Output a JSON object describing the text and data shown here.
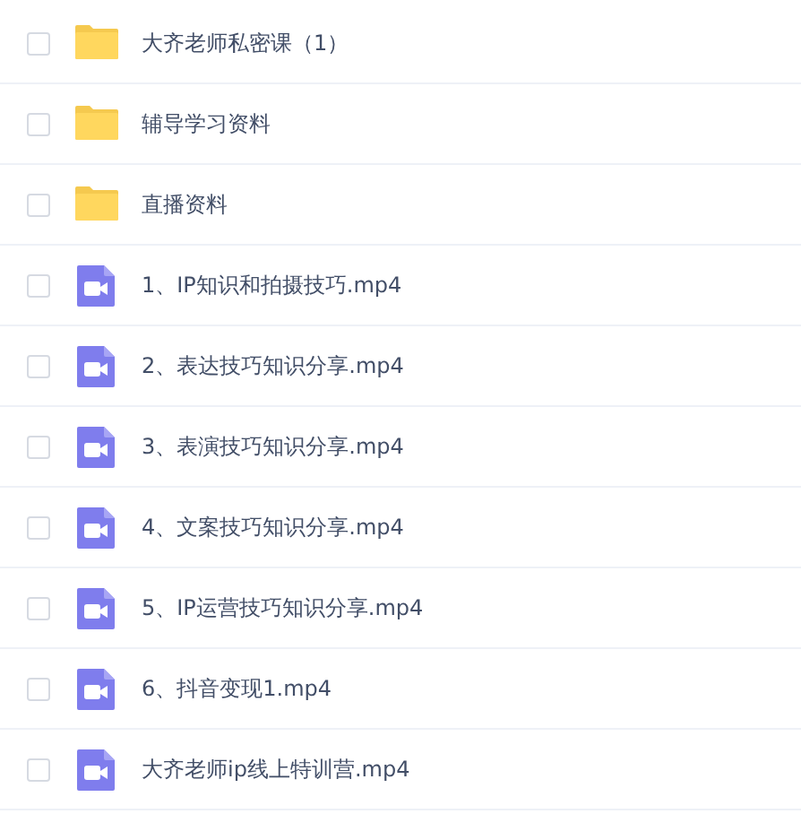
{
  "files": [
    {
      "kind": "folder",
      "name": "大齐老师私密课（1）",
      "checked": false
    },
    {
      "kind": "folder",
      "name": "辅导学习资料",
      "checked": false
    },
    {
      "kind": "folder",
      "name": "直播资料",
      "checked": false
    },
    {
      "kind": "video",
      "name": "1、IP知识和拍摄技巧.mp4",
      "checked": false
    },
    {
      "kind": "video",
      "name": "2、表达技巧知识分享.mp4",
      "checked": false
    },
    {
      "kind": "video",
      "name": "3、表演技巧知识分享.mp4",
      "checked": false
    },
    {
      "kind": "video",
      "name": "4、文案技巧知识分享.mp4",
      "checked": false
    },
    {
      "kind": "video",
      "name": "5、IP运营技巧知识分享.mp4",
      "checked": false
    },
    {
      "kind": "video",
      "name": "6、抖音变现1.mp4",
      "checked": false
    },
    {
      "kind": "video",
      "name": "大齐老师ip线上特训营.mp4",
      "checked": false
    }
  ]
}
